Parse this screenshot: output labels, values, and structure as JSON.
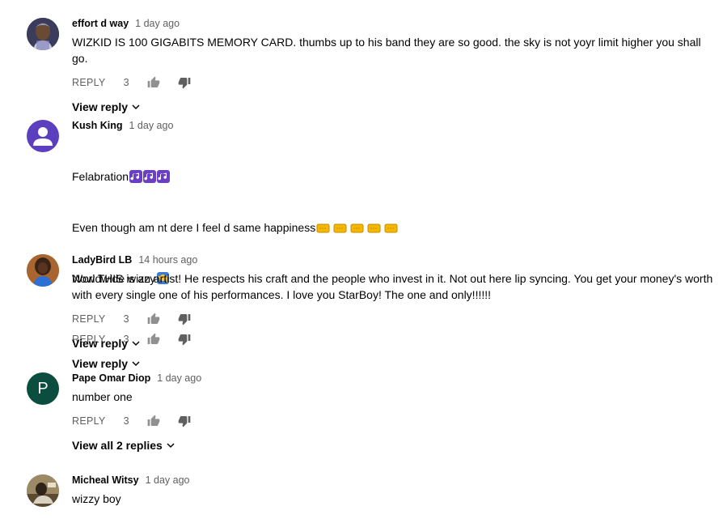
{
  "reply_label": "REPLY",
  "comments": [
    {
      "author": "effort d way",
      "time": "1 day ago",
      "text": "WIZKID IS 100 GIGABITS MEMORY CARD. thumbs up to his band they are so good. the sky is not yoyr limit higher you shall go.",
      "likes": "3",
      "replies_label": "View reply"
    },
    {
      "author": "Kush King",
      "time": "1 day ago",
      "line1": "Felabration",
      "line2": "Even though am nt dere I feel d same happiness",
      "line3": "Worldwide wizzy",
      "likes": "3",
      "replies_label": "View reply"
    },
    {
      "author": "LadyBird LB",
      "time": "14 hours ago",
      "text": "Now THIS is an artist! He respects his craft and the people who invest in it. Not out here lip syncing. You get your money's worth with every single one of his performances. I love you StarBoy! The one and only!!!!!!",
      "likes": "3",
      "replies_label": "View reply"
    },
    {
      "author": "Pape Omar Diop",
      "time": "1 day ago",
      "text": "number one",
      "avatar_initial": "P",
      "likes": "3",
      "replies_label": "View all 2 replies"
    },
    {
      "author": "Micheal Witsy",
      "time": "1 day ago",
      "text": "wizzy boy"
    }
  ],
  "colors": {
    "accent_purple": "#5c3fbf",
    "avatar_green": "#0b4d3e",
    "text_secondary": "#606060"
  },
  "icons": [
    "thumbs-up-icon",
    "thumbs-down-icon",
    "chevron-down-icon",
    "musical-notes-emoji",
    "ticket-emoji",
    "raised-hands-emoji"
  ]
}
